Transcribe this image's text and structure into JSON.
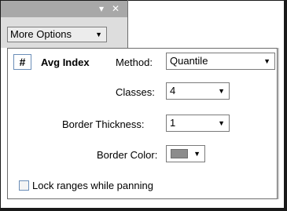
{
  "titlebar": {
    "dropdown_icon": "▾",
    "close_icon": "✕"
  },
  "toolbar": {
    "more_options_label": "More Options",
    "more_options_caret": "▼"
  },
  "panel": {
    "field_icon": "#",
    "field_name": "Avg Index",
    "method": {
      "label": "Method:",
      "value": "Quantile"
    },
    "classes": {
      "label": "Classes:",
      "value": "4"
    },
    "border_thickness": {
      "label": "Border Thickness:",
      "value": "1"
    },
    "border_color": {
      "label": "Border Color:",
      "value": "#8c8c8c"
    },
    "lock_ranges": {
      "label": "Lock ranges while panning",
      "checked": false
    },
    "combo_arrow": "▼"
  }
}
